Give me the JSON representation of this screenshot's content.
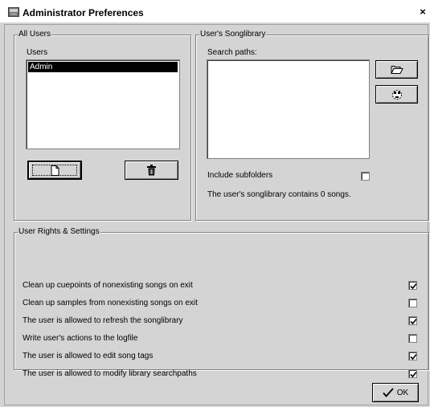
{
  "window": {
    "title": "Administrator Preferences",
    "close_glyph": "×"
  },
  "all_users": {
    "group_label": "All Users",
    "list_label": "Users",
    "users": [
      {
        "name": "Admin",
        "selected": true
      }
    ],
    "new_user_icon": "new-document-icon",
    "delete_user_icon": "trash-icon"
  },
  "songlibrary": {
    "group_label": "User's Songlibrary",
    "search_paths_label": "Search paths:",
    "add_path_icon": "folder-open-icon",
    "remove_path_icon": "remove-path-icon",
    "include_subfolders_label": "Include subfolders",
    "include_subfolders_checked": false,
    "status_text": "The user's songlibrary contains 0 songs."
  },
  "rights": {
    "group_label": "User Rights & Settings",
    "settings": [
      {
        "label": "Clean up cuepoints of nonexisting songs on exit",
        "checked": true
      },
      {
        "label": "Clean up samples from nonexisting songs on exit",
        "checked": false
      },
      {
        "label": "The user is allowed to refresh the songlibrary",
        "checked": true
      },
      {
        "label": "Write user's actions to the logfile",
        "checked": false
      },
      {
        "label": "The user is allowed to edit song tags",
        "checked": true
      },
      {
        "label": "The user is allowed to modify library searchpaths",
        "checked": true
      }
    ]
  },
  "footer": {
    "ok_label": "OK",
    "ok_icon": "checkmark-icon"
  }
}
